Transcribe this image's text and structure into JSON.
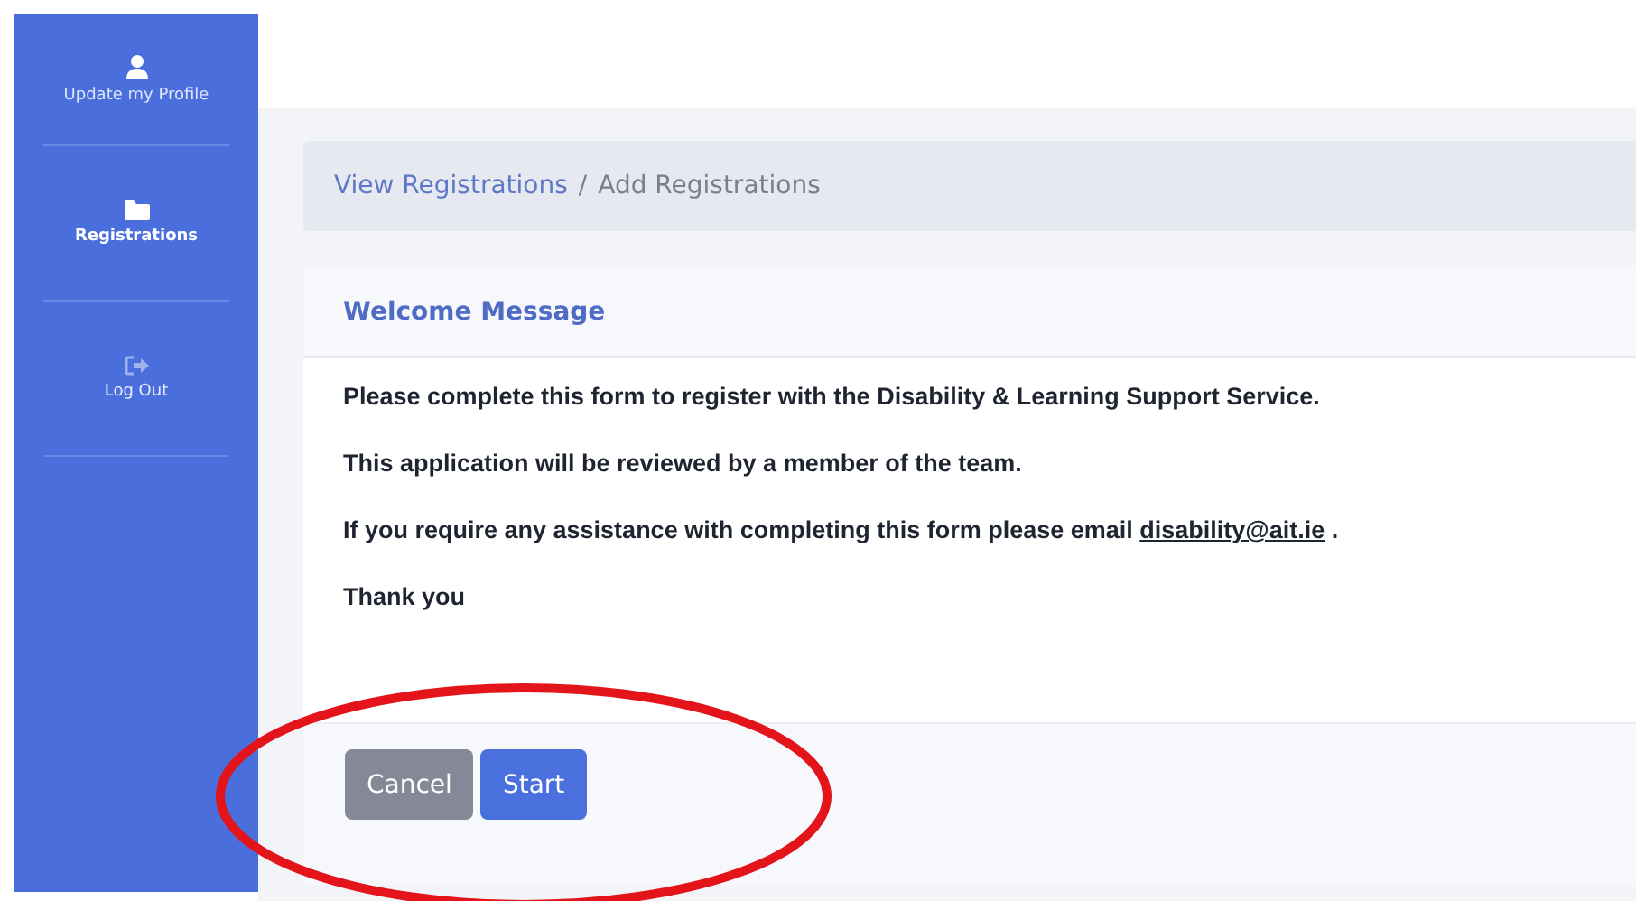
{
  "sidebar": {
    "items": [
      {
        "kind": "user",
        "label": "Update my Profile",
        "selected": false
      },
      {
        "kind": "folder",
        "label": "Registrations",
        "selected": true
      },
      {
        "kind": "logout",
        "label": "Log Out",
        "selected": false
      }
    ]
  },
  "breadcrumb": [
    {
      "label": "View Registrations",
      "kind": "link"
    },
    {
      "label": "/",
      "kind": "separator"
    },
    {
      "label": "Add Registrations",
      "kind": "current"
    }
  ],
  "card": {
    "title": "Welcome Message",
    "paragraphs": [
      {
        "text": "Please complete this form to register with the Disability & Learning Support Service."
      },
      {
        "text": "This application will be reviewed by a member of the team."
      },
      {
        "text": "If you require any assistance with completing this form please email",
        "link": "disability@ait.ie",
        "after": "."
      },
      {
        "text": "Thank you"
      }
    ],
    "buttons": [
      {
        "label": "Cancel",
        "kind": "secondary"
      },
      {
        "label": "Start",
        "kind": "primary"
      }
    ]
  },
  "annotation": {
    "kind": "ellipse"
  }
}
